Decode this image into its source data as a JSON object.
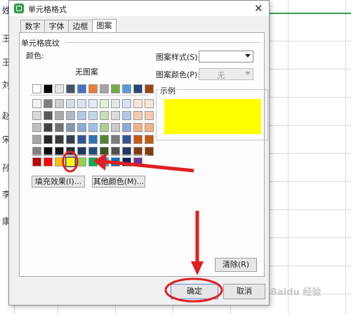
{
  "dialog": {
    "title": "单元格格式",
    "tabs": [
      {
        "label": "数字"
      },
      {
        "label": "字体"
      },
      {
        "label": "边框"
      },
      {
        "label": "图案",
        "active": true
      }
    ],
    "section_title": "单元格底纹",
    "color_label": "颜色:",
    "no_pattern": "无图案",
    "pattern_style_label": "图案样式(S):",
    "pattern_style_value": "",
    "pattern_color_label": "图案颜色(P):",
    "pattern_color_value": "无",
    "preview_label": "示例",
    "preview_color": "#FFFF00",
    "fill_effects_button": "填充效果(I)...",
    "more_colors_button": "其他颜色(M)...",
    "clear_button": "清除(R)",
    "ok_button": "确定",
    "cancel_button": "取消"
  },
  "palette": {
    "top_row": [
      "#FFFFFF",
      "#000000",
      "#E7E6E6",
      "#44546A",
      "#4472C4",
      "#ED7D31",
      "#A5A5A5",
      "#70AD47",
      "#5B9BD5",
      "#264478",
      "#9E480E"
    ],
    "tint_rows": [
      [
        "#F2F2F2",
        "#7F7F7F",
        "#D0CECE",
        "#D6DCE4",
        "#D9E1F2",
        "#DDEBF7",
        "#E2EFDA",
        "#E7E6E6",
        "#D9E1F2",
        "#FCE4D6",
        "#FBE5D6"
      ],
      [
        "#D9D9D9",
        "#595959",
        "#AEAAAA",
        "#ADB9CA",
        "#B4C6E7",
        "#BDD7EE",
        "#C6E0B4",
        "#DBDBDB",
        "#B4C6E7",
        "#F8CBAD",
        "#F7CAAC"
      ],
      [
        "#BFBFBF",
        "#404040",
        "#757171",
        "#8497B0",
        "#8EA9DB",
        "#9BC2E6",
        "#A9D08E",
        "#C9C9C9",
        "#8EA9DB",
        "#F4B084",
        "#F4B183"
      ],
      [
        "#A6A6A6",
        "#262626",
        "#3A3838",
        "#333F4F",
        "#305496",
        "#2F75B5",
        "#548235",
        "#7B7B7B",
        "#305496",
        "#C65911",
        "#C55A11"
      ],
      [
        "#808080",
        "#0D0D0D",
        "#161616",
        "#222B35",
        "#203764",
        "#1F4E78",
        "#375623",
        "#525252",
        "#203764",
        "#833C0C",
        "#843C0C"
      ]
    ],
    "standard_row": [
      "#C00000",
      "#FF0000",
      "#FFC000",
      "#FFFF00",
      "#92D050",
      "#00B050",
      "#00B0F0",
      "#0070C0",
      "#002060",
      "#7030A0"
    ],
    "selected": "#FFFF00"
  },
  "sheet": {
    "row_chars": [
      "姓",
      "王",
      "刘",
      "赵",
      "宋",
      "孙",
      "李",
      "康"
    ]
  },
  "annotations": {
    "accent_color": "#E02020"
  },
  "watermark": "Baidu 经验"
}
